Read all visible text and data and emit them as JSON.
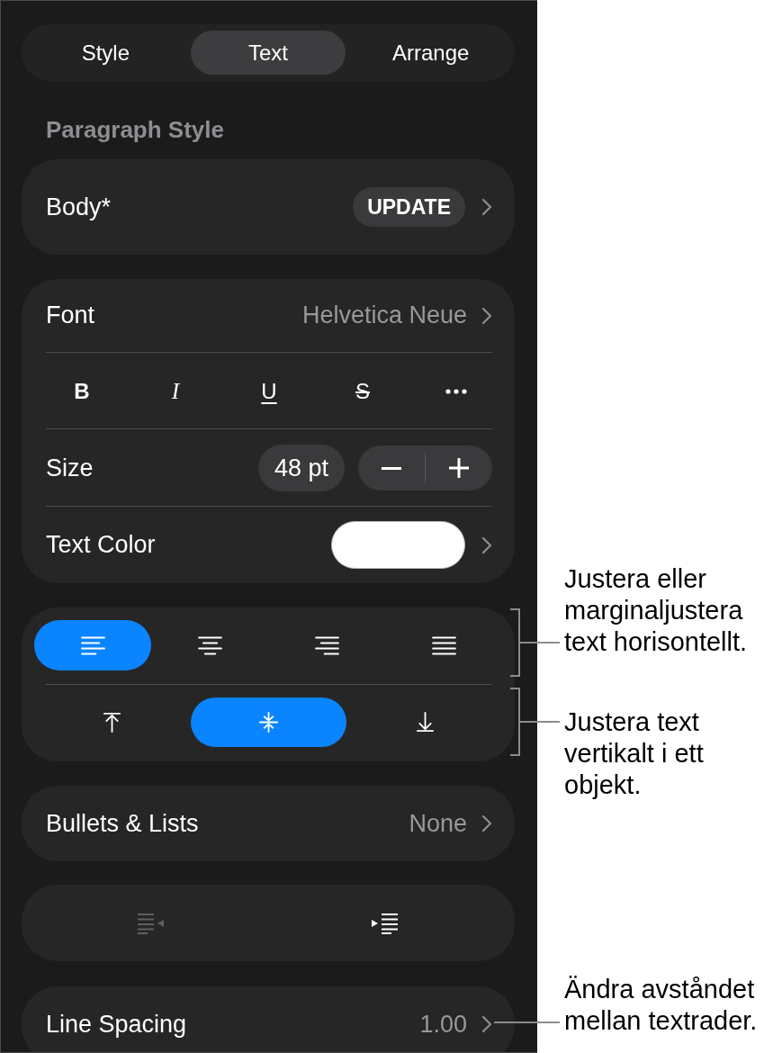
{
  "tabs": [
    {
      "label": "Style",
      "selected": false
    },
    {
      "label": "Text",
      "selected": true
    },
    {
      "label": "Arrange",
      "selected": false
    }
  ],
  "paragraph_style": {
    "heading": "Paragraph Style",
    "name": "Body*",
    "update_button": "UPDATE"
  },
  "font": {
    "label": "Font",
    "value": "Helvetica Neue"
  },
  "format_buttons": [
    {
      "kind": "bold",
      "label": "B"
    },
    {
      "kind": "italic",
      "label": "I"
    },
    {
      "kind": "underline",
      "label": "U"
    },
    {
      "kind": "strikethrough",
      "label": "S"
    },
    {
      "kind": "more"
    }
  ],
  "size": {
    "label": "Size",
    "value": "48 pt"
  },
  "text_color": {
    "label": "Text Color",
    "color": "#ffffff"
  },
  "horizontal_alignment": [
    {
      "kind": "left",
      "selected": true
    },
    {
      "kind": "center",
      "selected": false
    },
    {
      "kind": "right",
      "selected": false
    },
    {
      "kind": "justify",
      "selected": false
    }
  ],
  "vertical_alignment": [
    {
      "kind": "top",
      "selected": false
    },
    {
      "kind": "middle",
      "selected": true
    },
    {
      "kind": "bottom",
      "selected": false
    }
  ],
  "bullets": {
    "label": "Bullets & Lists",
    "value": "None"
  },
  "indent_buttons": [
    {
      "kind": "decrease",
      "disabled": true
    },
    {
      "kind": "increase",
      "disabled": false
    }
  ],
  "line_spacing": {
    "label": "Line Spacing",
    "value": "1.00"
  },
  "callouts": [
    {
      "kind": "bracket",
      "text": "Justera eller marginaljustera text horisontellt."
    },
    {
      "kind": "bracket",
      "text": "Justera text vertikalt i ett objekt."
    },
    {
      "kind": "line",
      "text": "Ändra avståndet mellan textrader."
    }
  ]
}
